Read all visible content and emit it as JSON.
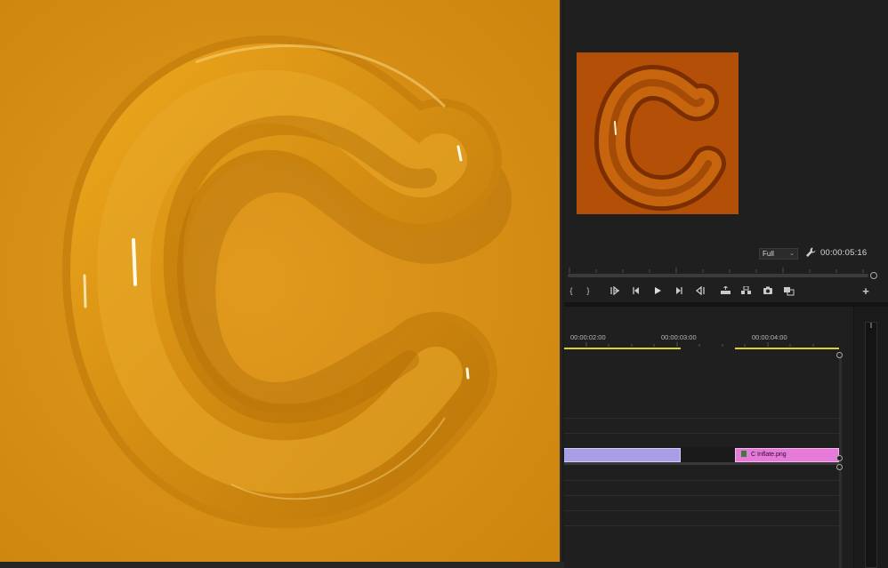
{
  "program_monitor": {
    "zoom_level": "Full",
    "timecode": "00:00:05:16",
    "transport": {
      "mark_in": "{",
      "mark_out": "}",
      "go_to_in": "{←",
      "step_back": "◀|",
      "play": "▶",
      "step_forward": "|▶",
      "go_to_out": "→}",
      "lift": "lift",
      "extract": "extract",
      "export_frame": "camera",
      "comparison": "compare",
      "add": "+"
    }
  },
  "timeline": {
    "time_labels": [
      "00:00:02:00",
      "00:00:03:00",
      "00:00:04:00"
    ],
    "clips": [
      {
        "name": "C Inflate.png",
        "color": "#e57ad9"
      }
    ]
  },
  "colors": {
    "preview_bg": "#d98f17",
    "thumb_bg": "#b34f06",
    "clip_purple": "#a79ee7",
    "clip_pink": "#e57ad9",
    "workarea": "#d9d22f"
  }
}
